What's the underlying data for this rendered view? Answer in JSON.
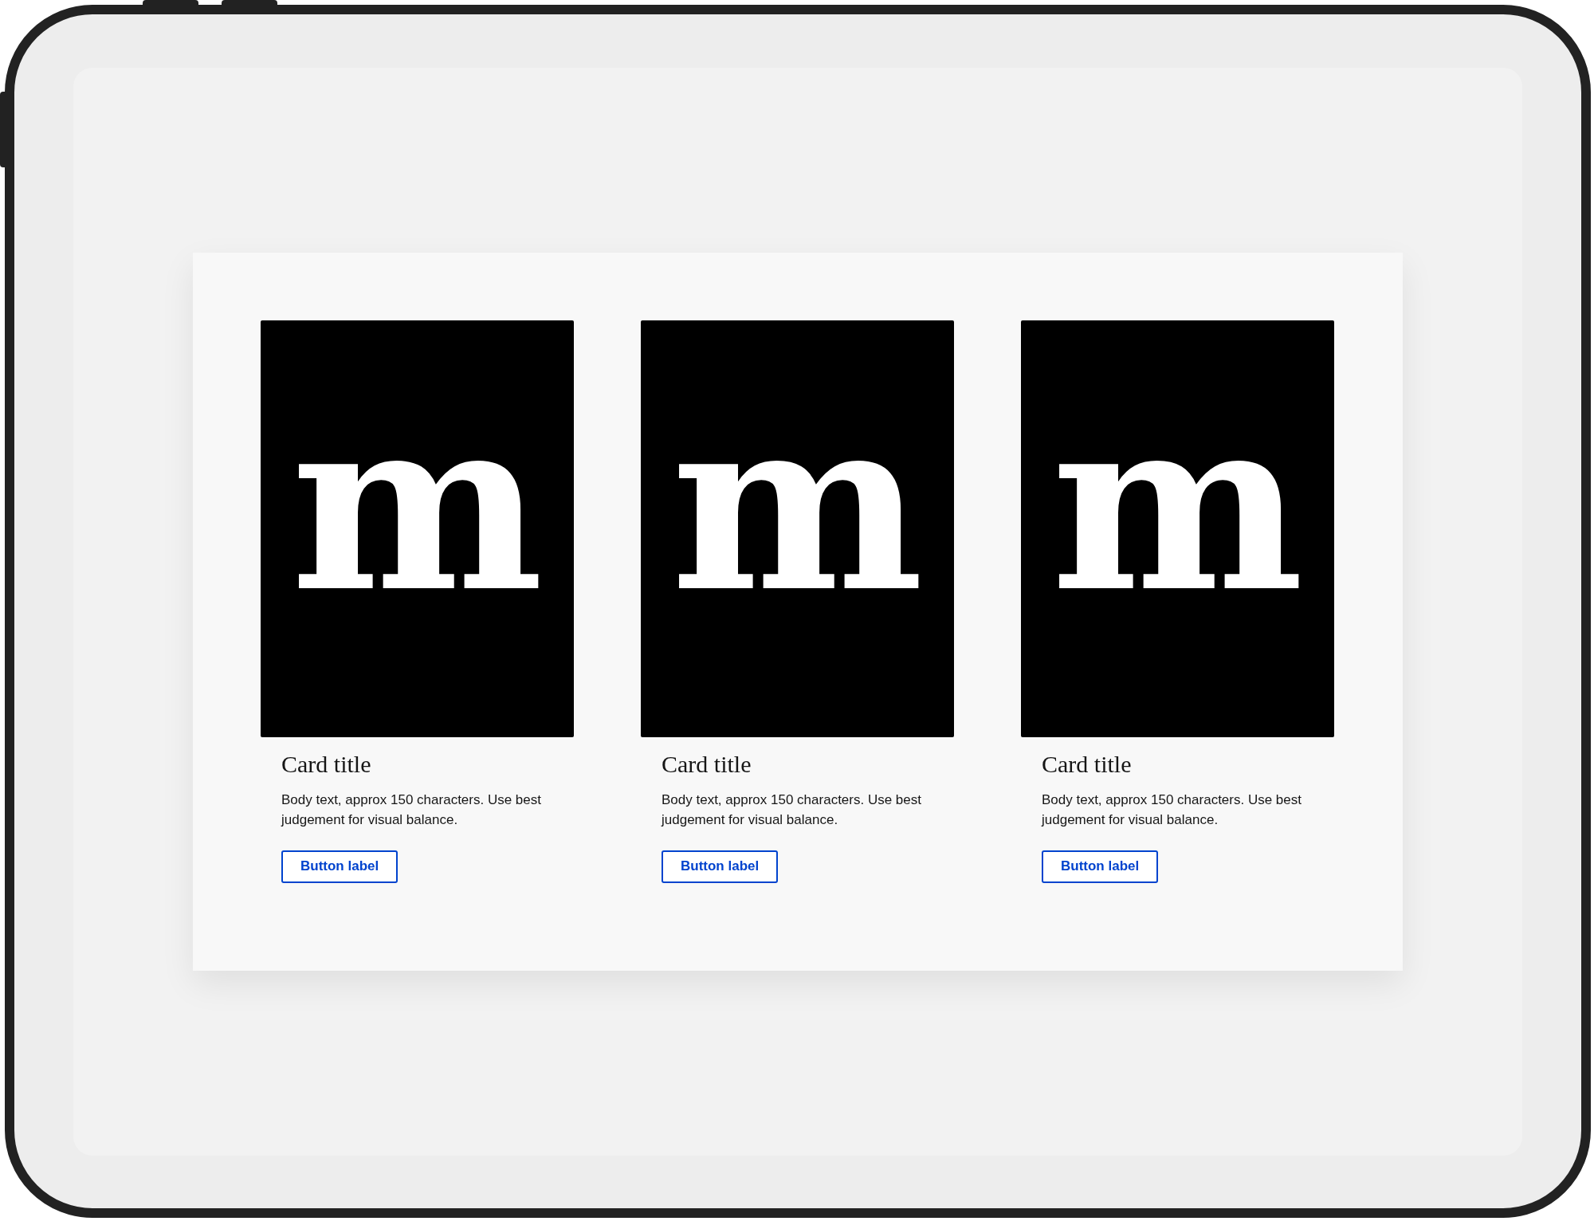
{
  "cards": [
    {
      "image_letter": "m",
      "title": "Card title",
      "body": "Body text, approx 150 characters. Use best judgement for visual balance.",
      "button": "Button label"
    },
    {
      "image_letter": "m",
      "title": "Card title",
      "body": "Body text, approx 150 characters. Use best judgement for visual balance.",
      "button": "Button label"
    },
    {
      "image_letter": "m",
      "title": "Card title",
      "body": "Body text, approx 150 characters. Use best judgement for visual balance.",
      "button": "Button label"
    }
  ]
}
